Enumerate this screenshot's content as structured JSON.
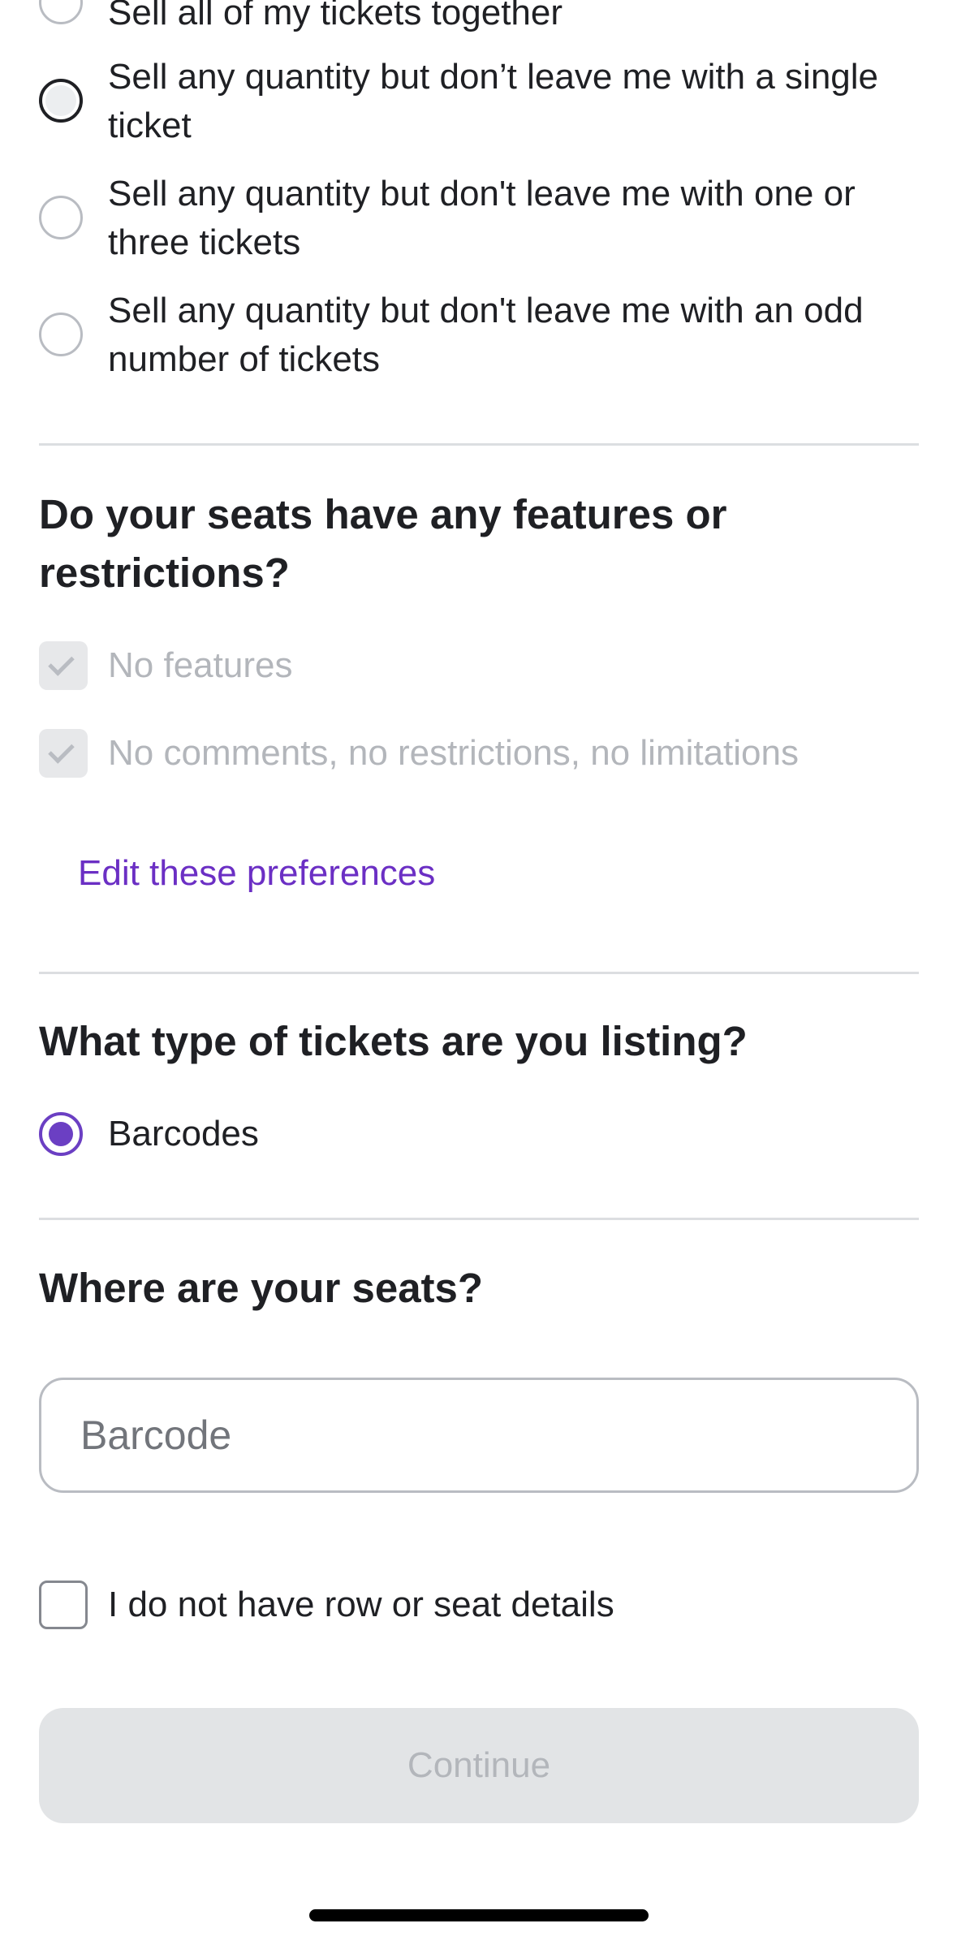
{
  "split_options": [
    {
      "label": "Sell all of my tickets together",
      "state": "unselected"
    },
    {
      "label": "Sell any quantity but don’t leave me with a single ticket",
      "state": "focused"
    },
    {
      "label": "Sell any quantity but don't leave me with one or three tickets",
      "state": "unselected"
    },
    {
      "label": "Sell any quantity but don't leave me with an odd number of tickets",
      "state": "unselected"
    }
  ],
  "features": {
    "heading": "Do your seats have any features or restrictions?",
    "items": [
      {
        "label": "No features",
        "checked": true,
        "disabled": true
      },
      {
        "label": "No comments, no restrictions, no limitations",
        "checked": true,
        "disabled": true
      }
    ],
    "edit_link": "Edit these preferences"
  },
  "ticket_type": {
    "heading": "What type of tickets are you listing?",
    "options": [
      {
        "label": "Barcodes",
        "selected": true
      }
    ]
  },
  "seats": {
    "heading": "Where are your seats?",
    "input_placeholder": "Barcode",
    "input_value": "",
    "no_details_label": "I do not have row or seat details",
    "no_details_checked": false
  },
  "continue_label": "Continue",
  "colors": {
    "accent": "#6b3fc3",
    "link": "#6b2fc4",
    "disabled_text": "#b3b6bb",
    "disabled_bg": "#e2e4e6"
  }
}
